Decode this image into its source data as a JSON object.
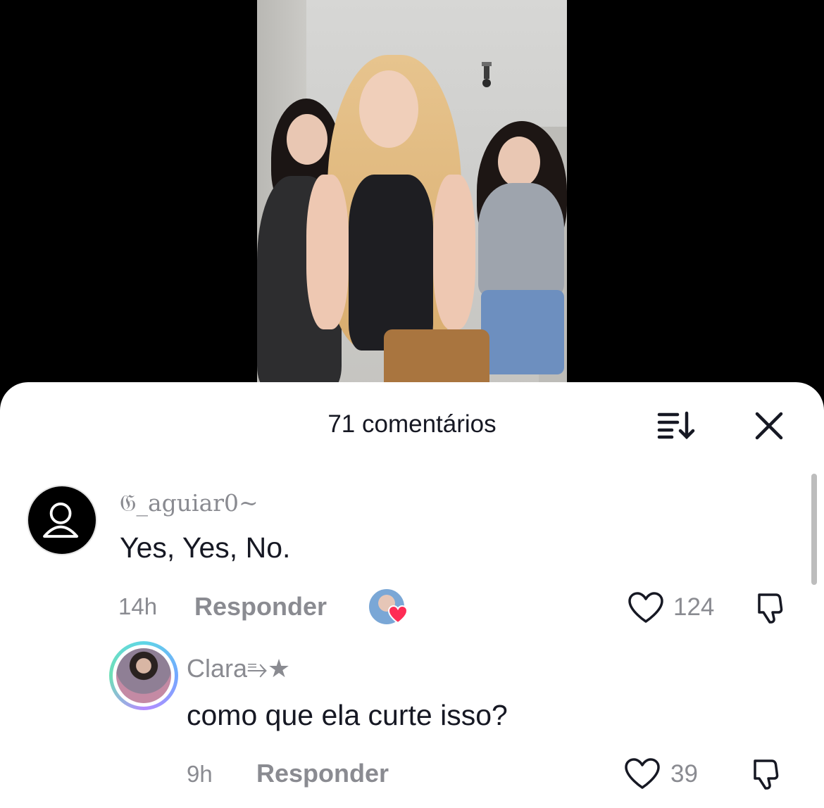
{
  "sheet": {
    "title": "71 comentários"
  },
  "icons": {
    "sort": "sort-icon",
    "close": "close-icon",
    "heart": "heart-icon",
    "dislike": "dislike-icon"
  },
  "colors": {
    "text_primary": "#161823",
    "text_secondary": "#8a8b91",
    "like_heart": "#fe2c55"
  },
  "comments": [
    {
      "username": "𝔊_aguiar0~",
      "text": "Yes, Yes, No.",
      "time": "14h",
      "reply_label": "Responder",
      "likes": "124",
      "liked_by_creator": true
    },
    {
      "username": "Clara⥱★",
      "text": "como que ela curte isso?",
      "time": "9h",
      "reply_label": "Responder",
      "likes": "39"
    }
  ]
}
